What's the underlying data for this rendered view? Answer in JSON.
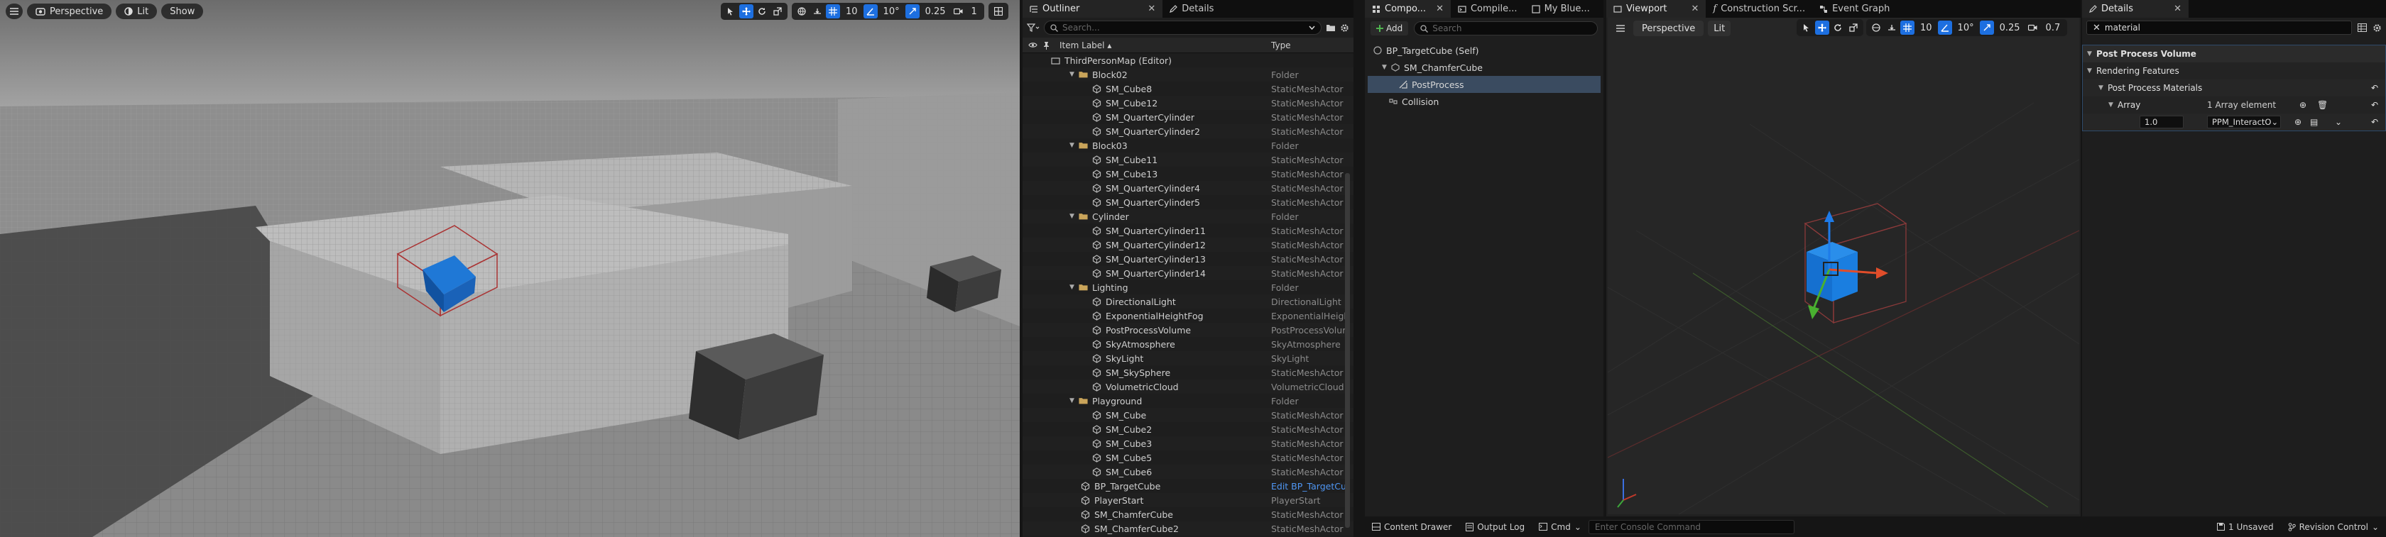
{
  "level_viewport": {
    "perspective_label": "Perspective",
    "lit_label": "Lit",
    "show_label": "Show",
    "grid_snap": "10",
    "rotation_snap": "10°",
    "scale_snap": "0.25",
    "camera_speed": "1"
  },
  "outliner": {
    "tab_label": "Outliner",
    "details_tab_label": "Details",
    "search_placeholder": "Search...",
    "col_item_label": "Item Label ▴",
    "col_type": "Type",
    "rows": [
      {
        "label": "ThirdPersonMap (Editor)",
        "type": ""
      },
      {
        "label": "Block02",
        "type": "Folder"
      },
      {
        "label": "SM_Cube8",
        "type": "StaticMeshActor"
      },
      {
        "label": "SM_Cube12",
        "type": "StaticMeshActor"
      },
      {
        "label": "SM_QuarterCylinder",
        "type": "StaticMeshActor"
      },
      {
        "label": "SM_QuarterCylinder2",
        "type": "StaticMeshActor"
      },
      {
        "label": "Block03",
        "type": "Folder"
      },
      {
        "label": "SM_Cube11",
        "type": "StaticMeshActor"
      },
      {
        "label": "SM_Cube13",
        "type": "StaticMeshActor"
      },
      {
        "label": "SM_QuarterCylinder4",
        "type": "StaticMeshActor"
      },
      {
        "label": "SM_QuarterCylinder5",
        "type": "StaticMeshActor"
      },
      {
        "label": "Cylinder",
        "type": "Folder"
      },
      {
        "label": "SM_QuarterCylinder11",
        "type": "StaticMeshActor"
      },
      {
        "label": "SM_QuarterCylinder12",
        "type": "StaticMeshActor"
      },
      {
        "label": "SM_QuarterCylinder13",
        "type": "StaticMeshActor"
      },
      {
        "label": "SM_QuarterCylinder14",
        "type": "StaticMeshActor"
      },
      {
        "label": "Lighting",
        "type": "Folder"
      },
      {
        "label": "DirectionalLight",
        "type": "DirectionalLight"
      },
      {
        "label": "ExponentialHeightFog",
        "type": "ExponentialHeightF"
      },
      {
        "label": "PostProcessVolume",
        "type": "PostProcessVolum"
      },
      {
        "label": "SkyAtmosphere",
        "type": "SkyAtmosphere"
      },
      {
        "label": "SkyLight",
        "type": "SkyLight"
      },
      {
        "label": "SM_SkySphere",
        "type": "StaticMeshActor"
      },
      {
        "label": "VolumetricCloud",
        "type": "VolumetricCloud"
      },
      {
        "label": "Playground",
        "type": "Folder"
      },
      {
        "label": "SM_Cube",
        "type": "StaticMeshActor"
      },
      {
        "label": "SM_Cube2",
        "type": "StaticMeshActor"
      },
      {
        "label": "SM_Cube3",
        "type": "StaticMeshActor"
      },
      {
        "label": "SM_Cube5",
        "type": "StaticMeshActor"
      },
      {
        "label": "SM_Cube6",
        "type": "StaticMeshActor"
      },
      {
        "label": "BP_TargetCube",
        "type": "Edit BP_TargetCub"
      },
      {
        "label": "PlayerStart",
        "type": "PlayerStart"
      },
      {
        "label": "SM_ChamferCube",
        "type": "StaticMeshActor"
      },
      {
        "label": "SM_ChamferCube2",
        "type": "StaticMeshActor"
      }
    ]
  },
  "components": {
    "tab_label": "Compo...",
    "compiler_tab": "Compile...",
    "myblueprint_tab": "My Blue...",
    "add_label": "Add",
    "search_placeholder": "Search",
    "items": [
      "BP_TargetCube (Self)",
      "SM_ChamferCube",
      "PostProcess",
      "Collision"
    ]
  },
  "bp_editor": {
    "viewport_tab": "Viewport",
    "construction_tab": "Construction Scr...",
    "eventgraph_tab": "Event Graph",
    "perspective_label": "Perspective",
    "lit_label": "Lit",
    "grid_snap": "10",
    "rotation_snap": "10°",
    "scale_snap": "0.25",
    "camera_speed": "0.7"
  },
  "details": {
    "tab_label": "Details",
    "search_value": "material",
    "section_ppv": "Post Process Volume",
    "section_rendering": "Rendering Features",
    "section_ppm": "Post Process Materials",
    "array_label": "Array",
    "array_value": "1 Array element",
    "weight_value": "1.0",
    "material_value": "PPM_InteractO"
  },
  "statusbar": {
    "content_drawer": "Content Drawer",
    "output_log": "Output Log",
    "cmd": "Cmd",
    "console_placeholder": "Enter Console Command",
    "unsaved": "1 Unsaved",
    "revision_control": "Revision Control"
  }
}
